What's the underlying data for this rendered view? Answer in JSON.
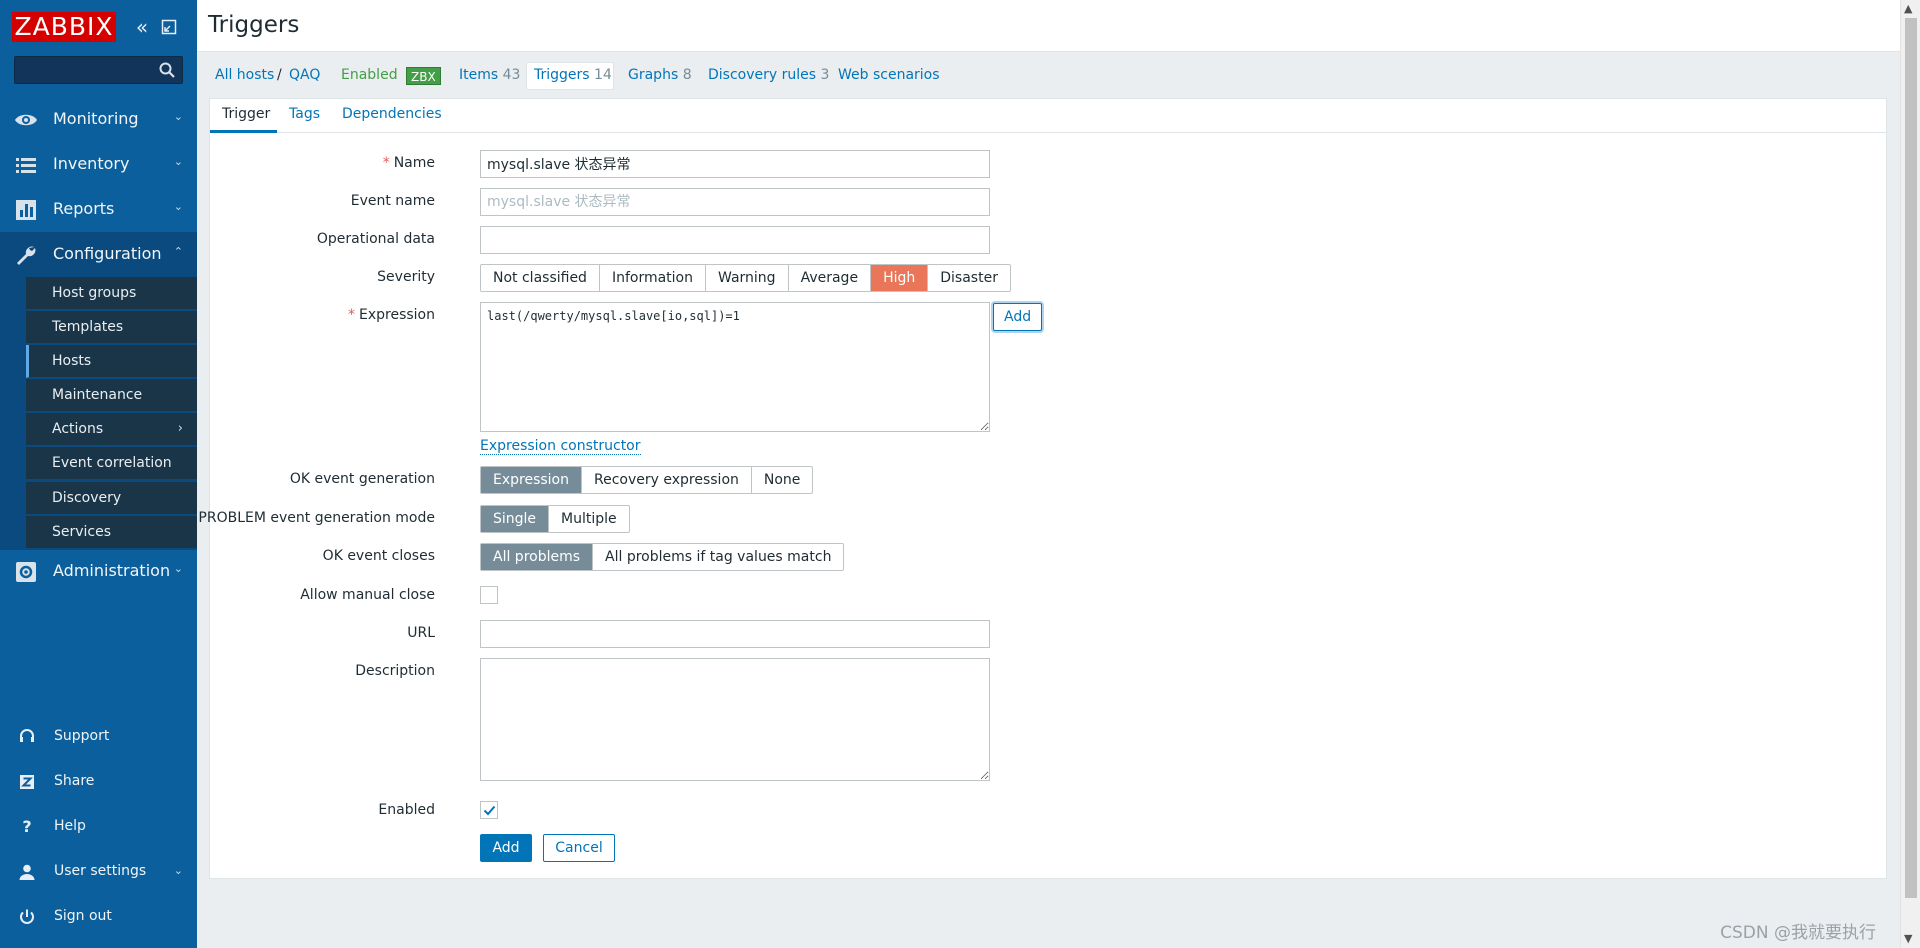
{
  "sidebar": {
    "logo": "ZABBIX",
    "search_placeholder": "",
    "menu": [
      {
        "label": "Monitoring",
        "icon": "eye-icon"
      },
      {
        "label": "Inventory",
        "icon": "list-icon"
      },
      {
        "label": "Reports",
        "icon": "bar-chart-icon"
      },
      {
        "label": "Configuration",
        "icon": "wrench-icon"
      },
      {
        "label": "Administration",
        "icon": "gear-icon"
      }
    ],
    "submenu": [
      {
        "label": "Host groups"
      },
      {
        "label": "Templates"
      },
      {
        "label": "Hosts"
      },
      {
        "label": "Maintenance"
      },
      {
        "label": "Actions"
      },
      {
        "label": "Event correlation"
      },
      {
        "label": "Discovery"
      },
      {
        "label": "Services"
      }
    ],
    "bottom": [
      {
        "label": "Support",
        "icon": "headset-icon"
      },
      {
        "label": "Share",
        "icon": "share-z-icon"
      },
      {
        "label": "Help",
        "icon": "question-icon"
      },
      {
        "label": "User settings",
        "icon": "user-icon"
      },
      {
        "label": "Sign out",
        "icon": "power-icon"
      }
    ]
  },
  "page": {
    "title": "Triggers"
  },
  "nav": {
    "all_hosts": "All hosts",
    "separator": "/",
    "host": "QAQ",
    "enabled": "Enabled",
    "zbx": "ZBX",
    "items_label": "Items",
    "items_count": "43",
    "triggers_label": "Triggers",
    "triggers_count": "14",
    "graphs_label": "Graphs",
    "graphs_count": "8",
    "discovery_label": "Discovery rules",
    "discovery_count": "3",
    "web_label": "Web scenarios"
  },
  "tabs": {
    "trigger": "Trigger",
    "tags": "Tags",
    "dependencies": "Dependencies"
  },
  "form": {
    "name_label": "Name",
    "name_value": "mysql.slave 状态异常",
    "event_name_label": "Event name",
    "event_name_placeholder": "mysql.slave 状态异常",
    "operational_data_label": "Operational data",
    "severity_label": "Severity",
    "severity_options": [
      "Not classified",
      "Information",
      "Warning",
      "Average",
      "High",
      "Disaster"
    ],
    "severity_selected": "High",
    "expression_label": "Expression",
    "expression_value": "last(/qwerty/mysql.slave[io,sql])=1",
    "expression_add": "Add",
    "expression_constructor": "Expression constructor",
    "ok_event_generation_label": "OK event generation",
    "ok_event_generation_options": [
      "Expression",
      "Recovery expression",
      "None"
    ],
    "problem_mode_label": "PROBLEM event generation mode",
    "problem_mode_options": [
      "Single",
      "Multiple"
    ],
    "ok_event_closes_label": "OK event closes",
    "ok_event_closes_options": [
      "All problems",
      "All problems if tag values match"
    ],
    "allow_manual_close_label": "Allow manual close",
    "allow_manual_close": false,
    "url_label": "URL",
    "url_value": "",
    "description_label": "Description",
    "description_value": "",
    "enabled_label": "Enabled",
    "enabled": true,
    "add_button": "Add",
    "cancel_button": "Cancel"
  },
  "watermark": "CSDN @我就要执行",
  "colors": {
    "sidebar": "#0b5f9c",
    "logo": "#d40000",
    "link": "#0275b8",
    "severity_high": "#e97659",
    "selected_segment": "#768d99",
    "enabled_green": "#429e47"
  }
}
